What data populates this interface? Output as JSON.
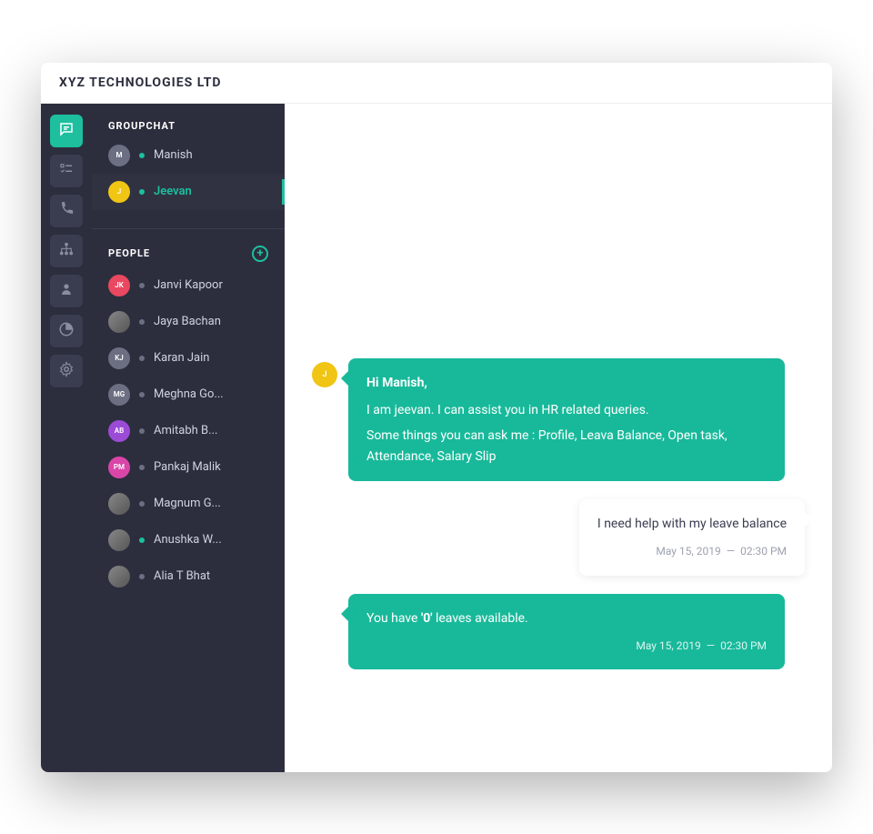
{
  "header": {
    "title": "XYZ TECHNOLOGIES LTD"
  },
  "sidebar": {
    "groupchat": {
      "label": "GROUPCHAT",
      "items": [
        {
          "name": "Manish",
          "initials": "M",
          "color": "#6c6f82",
          "online": true,
          "selected": false
        },
        {
          "name": "Jeevan",
          "initials": "J",
          "color": "#f0c514",
          "online": true,
          "selected": true
        }
      ]
    },
    "people": {
      "label": "PEOPLE",
      "items": [
        {
          "name": "Janvi Kapoor",
          "initials": "JK",
          "color": "#e94860",
          "online": false,
          "photo": false
        },
        {
          "name": "Jaya Bachan",
          "initials": "",
          "color": "#888",
          "online": false,
          "photo": true
        },
        {
          "name": "Karan Jain",
          "initials": "KJ",
          "color": "#6c6f82",
          "online": false,
          "photo": false
        },
        {
          "name": "Meghna Go...",
          "initials": "MG",
          "color": "#6c6f82",
          "online": false,
          "photo": false
        },
        {
          "name": "Amitabh B...",
          "initials": "AB",
          "color": "#9c4bd6",
          "online": false,
          "photo": false
        },
        {
          "name": "Pankaj Malik",
          "initials": "PM",
          "color": "#d946a8",
          "online": false,
          "photo": false
        },
        {
          "name": "Magnum G...",
          "initials": "",
          "color": "#888",
          "online": false,
          "photo": true
        },
        {
          "name": "Anushka W...",
          "initials": "",
          "color": "#888",
          "online": true,
          "photo": true
        },
        {
          "name": "Alia T Bhat",
          "initials": "",
          "color": "#888",
          "online": false,
          "photo": true
        }
      ]
    }
  },
  "chat": {
    "messages": [
      {
        "from": "bot",
        "avatar_initials": "J",
        "avatar_color": "#f0c514",
        "greeting": "Hi Manish,",
        "lines": [
          "I am jeevan. I can assist you in HR related queries.",
          "Some things you can ask me : Profile, Leava Balance, Open task, Attendance, Salary Slip"
        ]
      },
      {
        "from": "user",
        "text": "I need help with my leave balance",
        "date": "May 15, 2019",
        "time": "02:30 PM"
      },
      {
        "from": "bot",
        "text_before": "You have ",
        "text_bold": "'0'",
        "text_after": " leaves available.",
        "date": "May 15, 2019",
        "time": "02:30 PM"
      }
    ]
  }
}
